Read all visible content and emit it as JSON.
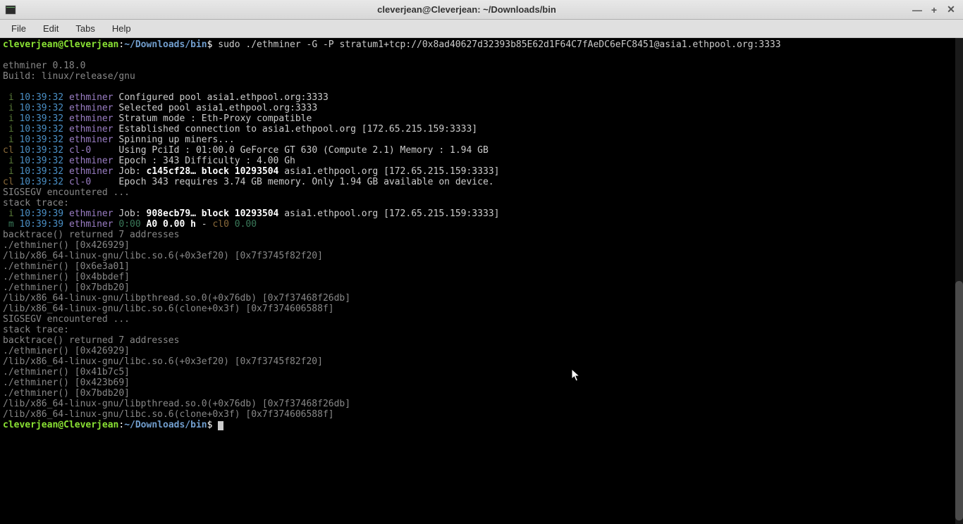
{
  "titlebar": {
    "title": "cleverjean@Cleverjean: ~/Downloads/bin"
  },
  "menubar": {
    "file": "File",
    "edit": "Edit",
    "tabs": "Tabs",
    "help": "Help"
  },
  "prompt": {
    "user_host": "cleverjean@Cleverjean",
    "colon": ":",
    "path": "~/Downloads/bin",
    "dollar": "$"
  },
  "command": "sudo ./ethminer -G -P stratum1+tcp://0x8ad40627d32393b85E62d1F64C7fAeDC6eFC8451@asia1.ethpool.org:3333",
  "version_line": "ethminer 0.18.0",
  "build_line": "Build: linux/release/gnu",
  "lines": [
    {
      "tag": " i",
      "tagc": "tag-i",
      "time": "10:39:32",
      "lbl": "ethminer",
      "lblc": "ethminer-lbl",
      "msg": "Configured pool asia1.ethpool.org:3333"
    },
    {
      "tag": " i",
      "tagc": "tag-i",
      "time": "10:39:32",
      "lbl": "ethminer",
      "lblc": "ethminer-lbl",
      "msg": "Selected pool asia1.ethpool.org:3333"
    },
    {
      "tag": " i",
      "tagc": "tag-i",
      "time": "10:39:32",
      "lbl": "ethminer",
      "lblc": "ethminer-lbl",
      "msg": "Stratum mode : Eth-Proxy compatible"
    },
    {
      "tag": " i",
      "tagc": "tag-i",
      "time": "10:39:32",
      "lbl": "ethminer",
      "lblc": "ethminer-lbl",
      "msg": "Established connection to asia1.ethpool.org [172.65.215.159:3333]"
    },
    {
      "tag": " i",
      "tagc": "tag-i",
      "time": "10:39:32",
      "lbl": "ethminer",
      "lblc": "ethminer-lbl",
      "msg": "Spinning up miners..."
    },
    {
      "tag": "cl",
      "tagc": "tag-cl",
      "time": "10:39:32",
      "lbl": "cl-0    ",
      "lblc": "cl-lbl",
      "msg": "Using PciId : 01:00.0 GeForce GT 630 (Compute 2.1) Memory : 1.94 GB"
    },
    {
      "tag": " i",
      "tagc": "tag-i",
      "time": "10:39:32",
      "lbl": "ethminer",
      "lblc": "ethminer-lbl",
      "msg": "Epoch : 343 Difficulty : 4.00 Gh"
    }
  ],
  "jobline1": {
    "tag": " i",
    "tagc": "tag-i",
    "time": "10:39:32",
    "lbl": "ethminer",
    "pre": "Job: ",
    "blk": "c145cf28… block 10293504",
    "post": " asia1.ethpool.org [172.65.215.159:3333]"
  },
  "clline": {
    "tag": "cl",
    "tagc": "tag-cl",
    "time": "10:39:32",
    "lbl": "cl-0    ",
    "msg": "Epoch 343 requires 3.74 GB memory. Only 1.94 GB available on device."
  },
  "sigsegv1": "SIGSEGV encountered ...",
  "stacktrace1": "stack trace:",
  "jobline2": {
    "tag": " i",
    "tagc": "tag-i",
    "time": "10:39:39",
    "lbl": "ethminer",
    "pre": "Job: ",
    "blk": "908ecb79… block 10293504",
    "post": " asia1.ethpool.org [172.65.215.159:3333]"
  },
  "mline": {
    "tag": " m",
    "tagc": "tag-m",
    "time": "10:39:39",
    "lbl": "ethminer",
    "g0": "0:00",
    "a0": " A0",
    "h": " 0.00 h",
    "dash": " - ",
    "cl0": "cl0",
    "cl0v": " 0.00"
  },
  "bt1": [
    "backtrace() returned 7 addresses",
    "./ethminer() [0x426929]",
    "/lib/x86_64-linux-gnu/libc.so.6(+0x3ef20) [0x7f3745f82f20]",
    "./ethminer() [0x6e3a01]",
    "./ethminer() [0x4bbdef]",
    "./ethminer() [0x7bdb20]",
    "/lib/x86_64-linux-gnu/libpthread.so.0(+0x76db) [0x7f37468f26db]",
    "/lib/x86_64-linux-gnu/libc.so.6(clone+0x3f) [0x7f374606588f]",
    "SIGSEGV encountered ...",
    "stack trace:",
    "backtrace() returned 7 addresses",
    "./ethminer() [0x426929]",
    "/lib/x86_64-linux-gnu/libc.so.6(+0x3ef20) [0x7f3745f82f20]",
    "./ethminer() [0x41b7c5]",
    "./ethminer() [0x423b69]",
    "./ethminer() [0x7bdb20]",
    "/lib/x86_64-linux-gnu/libpthread.so.0(+0x76db) [0x7f37468f26db]",
    "/lib/x86_64-linux-gnu/libc.so.6(clone+0x3f) [0x7f374606588f]"
  ]
}
